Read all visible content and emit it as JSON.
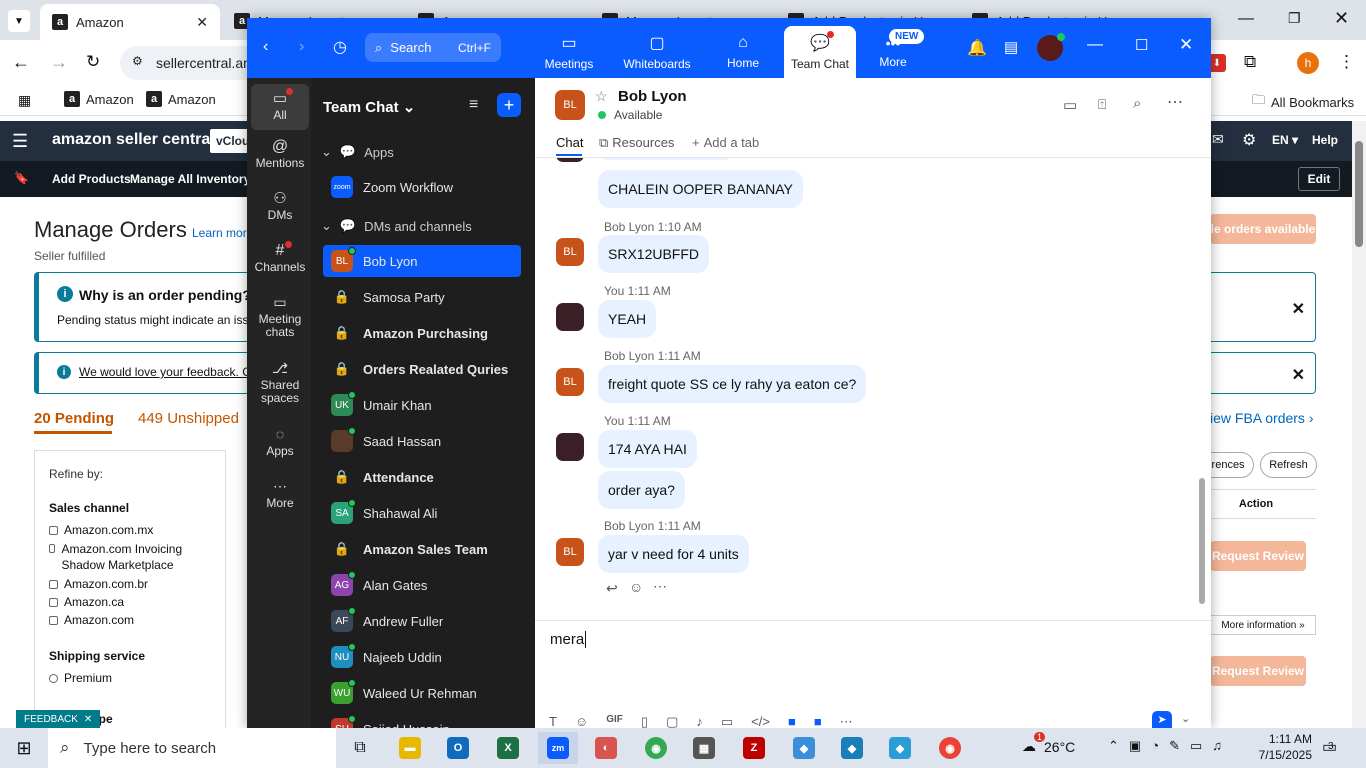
{
  "browser": {
    "tabs": [
      {
        "label": "Amazon",
        "favicon": "a"
      },
      {
        "label": "Manage Inventory",
        "favicon": "a"
      },
      {
        "label": "Amazon",
        "favicon": "a"
      },
      {
        "label": "Manage Inventory",
        "favicon": "a"
      },
      {
        "label": "Add Products via Up",
        "favicon": "a"
      },
      {
        "label": "Add Products via Up",
        "favicon": "a"
      }
    ],
    "url": "sellercentral.amazon.com",
    "bookmarks": [
      "Amazon",
      "Amazon"
    ],
    "all_bookmarks": "All Bookmarks",
    "profile_initial": "h"
  },
  "amazon": {
    "logo": "amazon seller central",
    "store_selector": "vCloud",
    "lang": "EN",
    "help": "Help",
    "nav": [
      "Add Products",
      "Manage All Inventory"
    ],
    "edit": "Edit",
    "page_title": "Manage Orders",
    "learn_more": "Learn more",
    "subtitle": "Seller fulfilled",
    "pending_title": "Why is an order pending?",
    "pending_text": "Pending status might indicate an issu",
    "feedback_text": "We would love your feedback. Cli",
    "tab_pending": "20 Pending",
    "tab_unshipped": "449 Unshipped",
    "refine_by": "Refine by:",
    "sales_channel": "Sales channel",
    "channels": [
      "Amazon.com.mx",
      "Amazon.com Invoicing Shadow Marketplace",
      "Amazon.com.br",
      "Amazon.ca",
      "Amazon.com"
    ],
    "shipping_service": "Shipping service",
    "premium": "Premium",
    "type_label": "ype",
    "feedback_tab": "FEEDBACK",
    "orders_available": "le orders available",
    "view_fba": "iew FBA orders",
    "preferences": "erences",
    "refresh": "Refresh",
    "action": "Action",
    "request_review": "Request Review",
    "more_info": "More information »",
    "colors": {
      "accent": "#f5b799",
      "dark": "#232f3e"
    }
  },
  "zoom": {
    "search_label": "Search",
    "search_shortcut": "Ctrl+F",
    "nav": [
      {
        "label": "Meetings",
        "icon": "video-icon"
      },
      {
        "label": "Whiteboards",
        "icon": "whiteboard-icon"
      },
      {
        "label": "Home",
        "icon": "home-icon"
      },
      {
        "label": "Team Chat",
        "icon": "chat-icon"
      },
      {
        "label": "More",
        "icon": "more-icon",
        "badge": "NEW"
      }
    ],
    "rail": [
      "All",
      "Mentions",
      "DMs",
      "Channels",
      "Meeting chats",
      "Shared spaces",
      "Apps",
      "More"
    ],
    "list_title": "Team Chat",
    "section_apps": "Apps",
    "app_item": "Zoom Workflow",
    "app_badge": "zoom",
    "section_dms": "DMs and channels",
    "items": [
      {
        "label": "Bob Lyon",
        "initials": "BL",
        "color": "#c8531a",
        "type": "dm"
      },
      {
        "label": "Samosa Party",
        "type": "channel"
      },
      {
        "label": "Amazon Purchasing",
        "type": "channel",
        "bold": true
      },
      {
        "label": "Orders Realated Quries",
        "type": "channel",
        "bold": true
      },
      {
        "label": "Umair Khan",
        "initials": "UK",
        "color": "#2e8b57",
        "type": "dm"
      },
      {
        "label": "Saad Hassan",
        "initials": "",
        "color": "#5a3b2a",
        "type": "dm"
      },
      {
        "label": "Attendance",
        "type": "channel",
        "bold": true
      },
      {
        "label": "Shahawal Ali",
        "initials": "SA",
        "color": "#2aa37a",
        "type": "dm"
      },
      {
        "label": "Amazon Sales Team",
        "type": "channel",
        "bold": true
      },
      {
        "label": "Alan Gates",
        "initials": "AG",
        "color": "#8e44ad",
        "type": "dm"
      },
      {
        "label": "Andrew Fuller",
        "initials": "AF",
        "color": "#3a4a5a",
        "type": "dm"
      },
      {
        "label": "Najeeb Uddin",
        "initials": "NU",
        "color": "#1f8fbf",
        "type": "dm"
      },
      {
        "label": "Waleed Ur Rehman",
        "initials": "WU",
        "color": "#3aa02e",
        "type": "dm"
      },
      {
        "label": "Sajjad Hussain",
        "initials": "SH",
        "color": "#c0392b",
        "type": "dm"
      }
    ],
    "chat": {
      "contact_name": "Bob Lyon",
      "contact_initials": "BL",
      "contact_status": "Available",
      "tabs": [
        "Chat",
        "Resources",
        "Add a tab"
      ],
      "messages": [
        {
          "sender": "",
          "time": "",
          "text": "CHALEIN OOPER BANANAY",
          "mine": false
        },
        {
          "sender": "Bob Lyon",
          "time": "1:10 AM",
          "text": "SRX12UBFFD",
          "mine": false
        },
        {
          "sender": "You",
          "time": "1:11 AM",
          "text": "YEAH",
          "mine": true
        },
        {
          "sender": "Bob Lyon",
          "time": "1:11 AM",
          "text": "freight quote SS ce ly rahy ya eaton ce?",
          "mine": false
        },
        {
          "sender": "You",
          "time": "1:11 AM",
          "text": "174 AYA HAI",
          "mine": true
        },
        {
          "sender": "",
          "time": "",
          "text": "order aya?",
          "mine": true
        },
        {
          "sender": "Bob Lyon",
          "time": "1:11 AM",
          "text": "yar v need for 4 units",
          "mine": false
        }
      ],
      "compose_value": "mera"
    }
  },
  "taskbar": {
    "search_placeholder": "Type here to search",
    "weather": "26°C",
    "weather_badge": "1",
    "time": "1:11 AM",
    "date": "7/15/2025",
    "notifications": "3"
  }
}
